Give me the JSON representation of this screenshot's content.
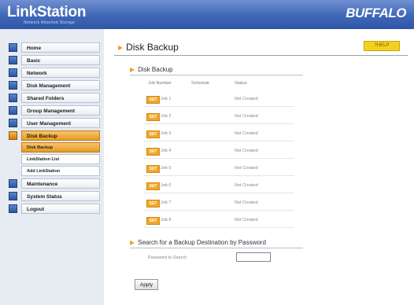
{
  "header": {
    "logo_text": "LinkStation",
    "logo_tagline": "Network Attached Storage",
    "brand": "BUFFALO"
  },
  "sidebar": {
    "items": [
      {
        "label": "Home"
      },
      {
        "label": "Basic"
      },
      {
        "label": "Network"
      },
      {
        "label": "Disk Management"
      },
      {
        "label": "Shared Folders"
      },
      {
        "label": "Group Management"
      },
      {
        "label": "User Management"
      },
      {
        "label": "Disk Backup",
        "active": true
      },
      {
        "label": "Maintenance"
      },
      {
        "label": "System Status"
      },
      {
        "label": "Logout"
      }
    ],
    "subitems": [
      {
        "label": "Disk Backup",
        "active": true
      },
      {
        "label": "LinkStation List"
      },
      {
        "label": "Add LinkStation"
      }
    ]
  },
  "main": {
    "title": "Disk Backup",
    "help_label": "?HELP",
    "section_backup": {
      "title": "Disk Backup",
      "columns": [
        "Job Number",
        "Schedule",
        "Status"
      ],
      "jobs": [
        {
          "badge": "SET",
          "label": "Job 1",
          "schedule": "",
          "status": "Not Created"
        },
        {
          "badge": "SET",
          "label": "Job 2",
          "schedule": "",
          "status": "Not Created"
        },
        {
          "badge": "SET",
          "label": "Job 3",
          "schedule": "",
          "status": "Not Created"
        },
        {
          "badge": "SET",
          "label": "Job 4",
          "schedule": "",
          "status": "Not Created"
        },
        {
          "badge": "SET",
          "label": "Job 5",
          "schedule": "",
          "status": "Not Created"
        },
        {
          "badge": "SET",
          "label": "Job 6",
          "schedule": "",
          "status": "Not Created"
        },
        {
          "badge": "SET",
          "label": "Job 7",
          "schedule": "",
          "status": "Not Created"
        },
        {
          "badge": "SET",
          "label": "Job 8",
          "schedule": "",
          "status": "Not Created"
        }
      ]
    },
    "section_password": {
      "title": "Search for a Backup Destination by Password",
      "field_label": "Password to Search",
      "field_value": ""
    },
    "apply_label": "Apply"
  },
  "colors": {
    "header_blue": "#3f66b8",
    "accent_orange": "#f1a62b",
    "help_yellow": "#f5d022",
    "sidebar_bg": "#e7ebf2"
  }
}
